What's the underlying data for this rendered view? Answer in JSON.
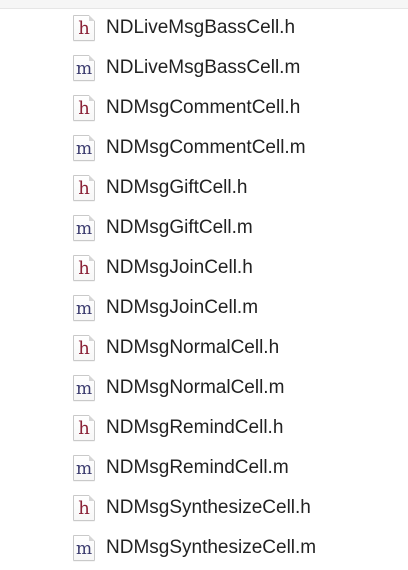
{
  "files": [
    {
      "name": "NDLiveMsgBassCell.h",
      "type": "h",
      "icon_letter": "h",
      "icon": "header-file-icon"
    },
    {
      "name": "NDLiveMsgBassCell.m",
      "type": "m",
      "icon_letter": "m",
      "icon": "implementation-file-icon"
    },
    {
      "name": "NDMsgCommentCell.h",
      "type": "h",
      "icon_letter": "h",
      "icon": "header-file-icon"
    },
    {
      "name": "NDMsgCommentCell.m",
      "type": "m",
      "icon_letter": "m",
      "icon": "implementation-file-icon"
    },
    {
      "name": "NDMsgGiftCell.h",
      "type": "h",
      "icon_letter": "h",
      "icon": "header-file-icon"
    },
    {
      "name": "NDMsgGiftCell.m",
      "type": "m",
      "icon_letter": "m",
      "icon": "implementation-file-icon"
    },
    {
      "name": "NDMsgJoinCell.h",
      "type": "h",
      "icon_letter": "h",
      "icon": "header-file-icon"
    },
    {
      "name": "NDMsgJoinCell.m",
      "type": "m",
      "icon_letter": "m",
      "icon": "implementation-file-icon"
    },
    {
      "name": "NDMsgNormalCell.h",
      "type": "h",
      "icon_letter": "h",
      "icon": "header-file-icon"
    },
    {
      "name": "NDMsgNormalCell.m",
      "type": "m",
      "icon_letter": "m",
      "icon": "implementation-file-icon"
    },
    {
      "name": "NDMsgRemindCell.h",
      "type": "h",
      "icon_letter": "h",
      "icon": "header-file-icon"
    },
    {
      "name": "NDMsgRemindCell.m",
      "type": "m",
      "icon_letter": "m",
      "icon": "implementation-file-icon"
    },
    {
      "name": "NDMsgSynthesizeCell.h",
      "type": "h",
      "icon_letter": "h",
      "icon": "header-file-icon"
    },
    {
      "name": "NDMsgSynthesizeCell.m",
      "type": "m",
      "icon_letter": "m",
      "icon": "implementation-file-icon"
    }
  ],
  "colors": {
    "header_letter": "#8a2136",
    "implementation_letter": "#3a3a6e",
    "filename_text": "#222222",
    "background": "#ffffff"
  }
}
